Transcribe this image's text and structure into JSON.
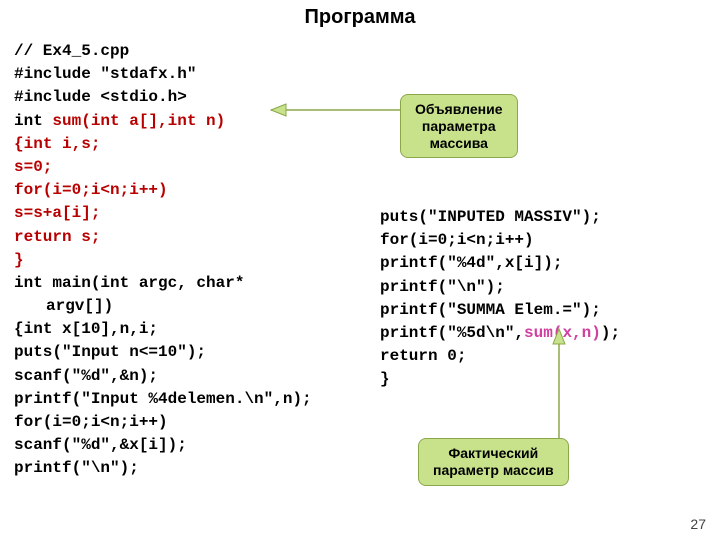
{
  "title": "Программа",
  "page_number": "27",
  "left": {
    "l1": "// Ex4_5.cpp",
    "l2": "#include \"stdafx.h\"",
    "l3": "#include <stdio.h>",
    "l4a": "int ",
    "l4b": "sum(int a[],int n)",
    "l5a": "{",
    "l5b": "int i,s;",
    "l6": " s=0;",
    "l7": " for(i=0;i<n;i++)",
    "l8": "  s=s+a[i];",
    "l9": " return s;",
    "l10": "}",
    "l11a": "int main(int argc, char*",
    "l11b": "argv[])",
    "l12a": "{",
    "l12b": "int x[10],n,i;",
    "l13": " puts(\"Input n<=10\");",
    "l14": " scanf(\"%d\",&n);",
    "l15": "printf(\"Input %4delemen.\\n\",n);",
    "l16": " for(i=0;i<n;i++)",
    "l17": " scanf(\"%d\",&x[i]);",
    "l18": "  printf(\"\\n\");"
  },
  "right": {
    "l1": "puts(\"INPUTED MASSIV\");",
    "l2": "for(i=0;i<n;i++)",
    "l3": "printf(\"%4d\",x[i]);",
    "l4": "printf(\"\\n\");",
    "l5": "printf(\"SUMMA Elem.=\");",
    "l6a": "printf(\"%5d\\n\",",
    "l6b": "sum(x,n)",
    "l6c": ");",
    "l7": "  return 0;",
    "l8": "}"
  },
  "callout_top": {
    "line1": "Объявление",
    "line2": "параметра",
    "line3": "массива"
  },
  "callout_bottom": {
    "line1": "Фактический",
    "line2": "параметр массив"
  }
}
